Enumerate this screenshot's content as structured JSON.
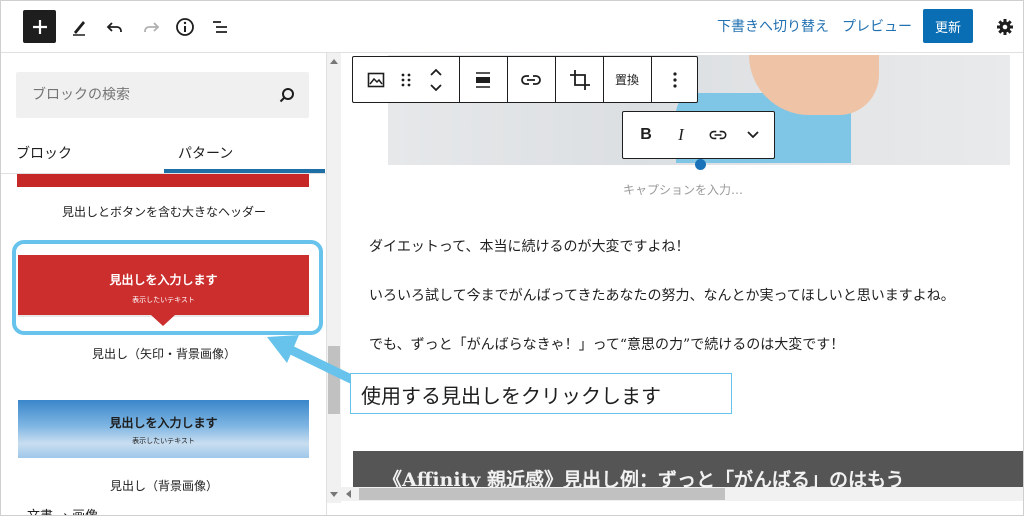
{
  "topbar": {
    "add_icon": "plus-icon",
    "tools_icon": "pencil-icon",
    "undo_icon": "undo-icon",
    "redo_icon": "redo-icon",
    "info_icon": "info-icon",
    "outline_icon": "list-view-icon",
    "save_draft_label": "下書きへ切り替え",
    "preview_label": "プレビュー",
    "update_label": "更新",
    "settings_icon": "gear-icon"
  },
  "sidebar": {
    "search_placeholder": "ブロックの検索",
    "tabs": [
      {
        "label": "ブロック",
        "active": false
      },
      {
        "label": "パターン",
        "active": true
      }
    ],
    "patterns": [
      {
        "label": "見出しとボタンを含む大きなヘッダー"
      },
      {
        "label": "見出し（矢印・背景画像）",
        "preview_heading": "見出しを入力します",
        "preview_sub": "表示したいテキスト",
        "highlighted": true
      },
      {
        "label": "見出し（背景画像）",
        "preview_heading": "見出しを入力します",
        "preview_sub": "表示したいテキスト"
      }
    ],
    "breadcrumb": "文書 → 画像"
  },
  "block_toolbar": {
    "replace_label": "置換",
    "icons": [
      "image-icon",
      "drag-handle-icon",
      "move-up-down-icon",
      "align-icon",
      "link-icon",
      "crop-icon",
      "more-options-icon"
    ]
  },
  "format_toolbar": {
    "bold_label": "B",
    "italic_label": "I",
    "icons": [
      "link-icon",
      "chevron-down-icon"
    ]
  },
  "editor": {
    "caption_placeholder": "キャプションを入力…",
    "paragraphs": [
      "ダイエットって、本当に続けるのが大変ですよね！",
      "いろいろ試して今までがんばってきたあなたの努力、なんとか実ってほしいと思いますよね。",
      "でも、ずっと「がんばらなきゃ！」って“意思の力”で続けるのは大変です！"
    ],
    "heading_text": "《Affinity 親近感》見出し例：ずっと「がんばる」のはもう"
  },
  "annotation": {
    "text": "使用する見出しをクリックします"
  },
  "colors": {
    "accent": "#0a6eb4",
    "highlight": "#67c3ec",
    "pattern_red": "#cc2d2d"
  }
}
